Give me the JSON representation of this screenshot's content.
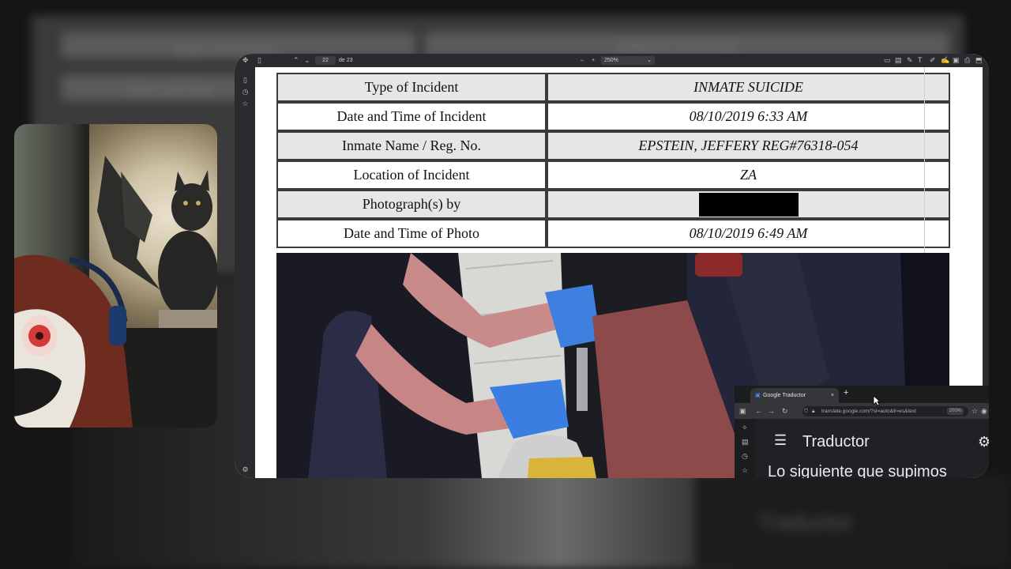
{
  "viewer": {
    "page_current": "22",
    "page_total": "de 23",
    "zoom": "250%",
    "zoom_minus": "–",
    "zoom_plus": "+"
  },
  "incident_table": {
    "rows": [
      {
        "label": "Type of Incident",
        "value": "INMATE SUICIDE"
      },
      {
        "label": "Date and Time of Incident",
        "value": "08/10/2019 6:33 AM"
      },
      {
        "label": "Inmate Name / Reg. No.",
        "value": "EPSTEIN, JEFFERY REG#76318-054"
      },
      {
        "label": "Location of Incident",
        "value": "ZA"
      },
      {
        "label": "Photograph(s) by",
        "value": ""
      },
      {
        "label": "Date and Time of Photo",
        "value": "08/10/2019 6:49 AM"
      }
    ]
  },
  "translator": {
    "tab_title": "Google Traductor",
    "new_tab": "+",
    "close_tab": "×",
    "url": "translate.google.com/?sl=auto&tl=es&text",
    "zoom": "200%",
    "app_title": "Traductor",
    "body_text": "Lo siguiente que supimos"
  },
  "background": {
    "blur_row1": "Type of Incident",
    "blur_row1_value": "INMATE SUICIDE",
    "blur_row2": "Date and Tim",
    "blur_trad": "Traductor"
  }
}
